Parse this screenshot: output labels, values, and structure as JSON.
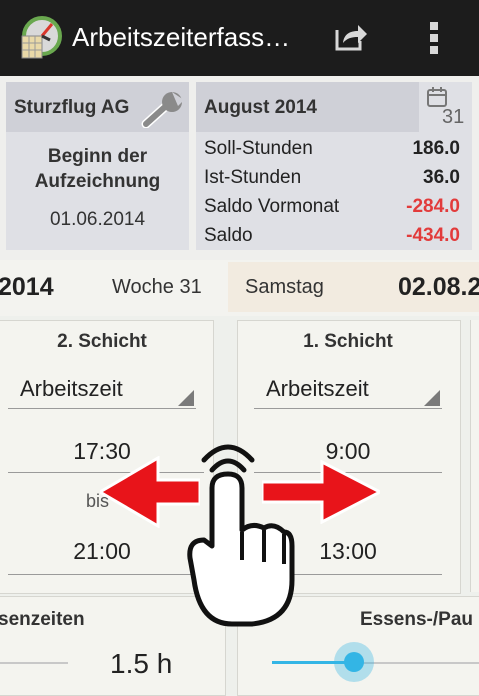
{
  "app": {
    "title": "Arbeitszeiterfass…"
  },
  "company_card": {
    "name": "Sturzflug AG",
    "label": "Beginn der Aufzeichnung",
    "date": "01.06.2014"
  },
  "month_card": {
    "month": "August 2014",
    "calendar_day": "31",
    "rows": [
      {
        "label": "Soll-Stunden",
        "value": "186.0"
      },
      {
        "label": "Ist-Stunden",
        "value": "36.0"
      },
      {
        "label": "Saldo Vormonat",
        "value": "-284.0"
      },
      {
        "label": "Saldo",
        "value": "-434.0"
      }
    ]
  },
  "date_strip": {
    "year": "2014",
    "week": "Woche 31",
    "weekday": "Samstag",
    "date": "02.08.2"
  },
  "shift_left": {
    "title": "2. Schicht",
    "type": "Arbeitszeit",
    "start": "17:30",
    "separator": "bis",
    "end": "21:00"
  },
  "shift_right": {
    "title": "1. Schicht",
    "type": "Arbeitszeit",
    "start": "9:00",
    "end": "13:00"
  },
  "bottom": {
    "left_label": "senzeiten",
    "left_value": "1.5 h",
    "right_label": "Essens-/Pau"
  },
  "colors": {
    "action_bar": "#1c1c1c",
    "negative": "#e23b3b",
    "arrow": "#e8141a",
    "slider": "#33b5e5"
  },
  "icons": [
    "app-logo-icon",
    "wrench-icon",
    "calendar-icon",
    "share-icon",
    "overflow-menu-icon",
    "swipe-hand-icon"
  ]
}
